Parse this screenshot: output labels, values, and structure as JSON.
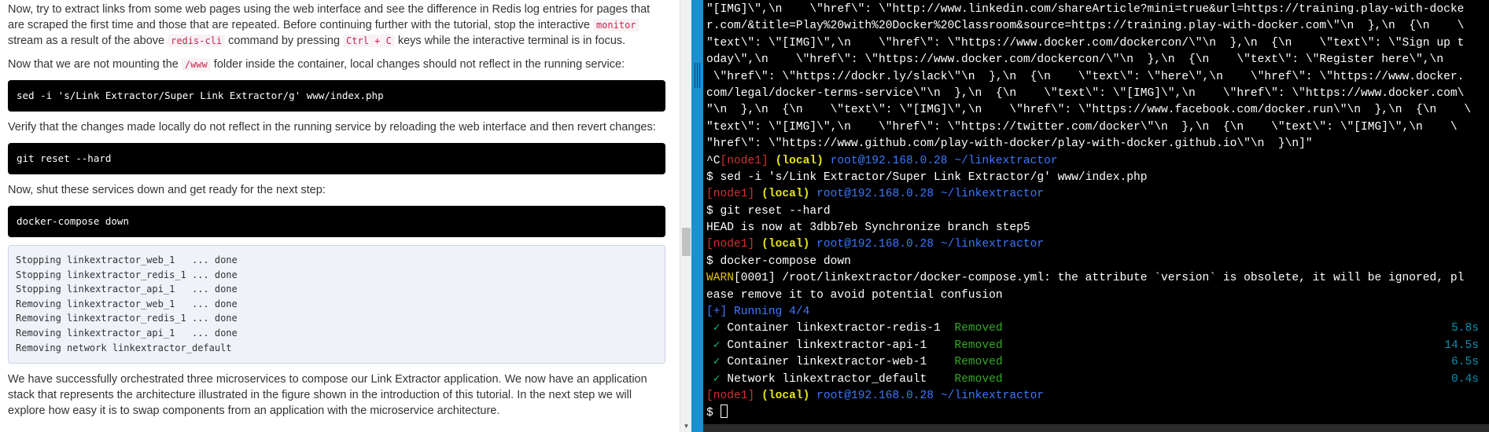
{
  "tutorial": {
    "p1": {
      "a": "Now, try to extract links from some web pages using the web interface and see the difference in Redis log entries for pages that are scraped the first time and those that are repeated. Before continuing further with the tutorial, stop the interactive ",
      "code1": "monitor",
      "b": " stream as a result of the above ",
      "code2": "redis-cli",
      "c": " command by pressing ",
      "kbd": "Ctrl + C",
      "d": " keys while the interactive terminal is in focus."
    },
    "p2": {
      "a": "Now that we are not mounting the ",
      "code": "/www",
      "b": " folder inside the container, local changes should not reflect in the running service:"
    },
    "cmd1": "sed -i 's/Link Extractor/Super Link Extractor/g' www/index.php",
    "p3": "Verify that the changes made locally do not reflect in the running service by reloading the web interface and then revert changes:",
    "cmd2": "git reset --hard",
    "p4": "Now, shut these services down and get ready for the next step:",
    "cmd3": "docker-compose down",
    "output_lines": [
      "Stopping linkextractor_web_1   ... done",
      "Stopping linkextractor_redis_1 ... done",
      "Stopping linkextractor_api_1   ... done",
      "Removing linkextractor_web_1   ... done",
      "Removing linkextractor_redis_1 ... done",
      "Removing linkextractor_api_1   ... done",
      "Removing network linkextractor_default"
    ],
    "p5": "We have successfully orchestrated three microservices to compose our Link Extractor application. We now have an application stack that represents the architecture illustrated in the figure shown in the introduction of this tutorial. In the next step we will explore how easy it is to swap components from an application with the microservice architecture."
  },
  "terminal": {
    "json_lines": [
      "\"[IMG]\\\",\\n    \\\"href\\\": \\\"http://www.linkedin.com/shareArticle?mini=true&url=https://training.play-with-docke",
      "r.com/&title=Play%20with%20Docker%20Classroom&source=https://training.play-with-docker.com\\\"\\n  },\\n  {\\n    \\",
      "\"text\\\": \\\"[IMG]\\\",\\n    \\\"href\\\": \\\"https://www.docker.com/dockercon/\\\"\\n  },\\n  {\\n    \\\"text\\\": \\\"Sign up t",
      "oday\\\",\\n    \\\"href\\\": \\\"https://www.docker.com/dockercon/\\\"\\n  },\\n  {\\n    \\\"text\\\": \\\"Register here\\\",\\n   ",
      " \\\"href\\\": \\\"https://dockr.ly/slack\\\"\\n  },\\n  {\\n    \\\"text\\\": \\\"here\\\",\\n    \\\"href\\\": \\\"https://www.docker.",
      "com/legal/docker-terms-service\\\"\\n  },\\n  {\\n    \\\"text\\\": \\\"[IMG]\\\",\\n    \\\"href\\\": \\\"https://www.docker.com\\",
      "\"\\n  },\\n  {\\n    \\\"text\\\": \\\"[IMG]\\\",\\n    \\\"href\\\": \\\"https://www.facebook.com/docker.run\\\"\\n  },\\n  {\\n    \\",
      "\"text\\\": \\\"[IMG]\\\",\\n    \\\"href\\\": \\\"https://twitter.com/docker\\\"\\n  },\\n  {\\n    \\\"text\\\": \\\"[IMG]\\\",\\n    \\",
      "\"href\\\": \\\"https://www.github.com/play-with-docker/play-with-docker.github.io\\\"\\n  }\\n]\""
    ],
    "interrupt": "^C",
    "prompt_node": "[node1]",
    "prompt_local": "(local)",
    "prompt_user": "root@192.168.0.28",
    "prompt_path": "~/linkextractor",
    "dollar": "$",
    "cmd1": "sed -i 's/Link Extractor/Super Link Extractor/g' www/index.php",
    "cmd2": "git reset --hard",
    "head_msg": "HEAD is now at 3dbb7eb Synchronize branch step5",
    "cmd3": "docker-compose down",
    "warn_tag": "WARN",
    "warn_line1": "[0001] /root/linkextractor/docker-compose.yml: the attribute `version` is obsolete, it will be ignored, pl",
    "warn_line2": "ease remove it to avoid potential confusion",
    "running": "[+] Running 4/4",
    "check": "✓",
    "containers": [
      {
        "name": "Container linkextractor-redis-1",
        "status": "Removed",
        "time": "5.8s"
      },
      {
        "name": "Container linkextractor-api-1",
        "status": "Removed",
        "time": "14.5s"
      },
      {
        "name": "Container linkextractor-web-1",
        "status": "Removed",
        "time": "6.5s"
      },
      {
        "name": "Network linkextractor_default",
        "status": "Removed",
        "time": "0.4s"
      }
    ]
  },
  "colors": {
    "splitter": "#1a8fd1",
    "terminal_bg": "#000000",
    "prompt_node": "#cd3131",
    "prompt_local": "#e5e510",
    "prompt_user": "#3b78ff",
    "removed": "#35a826"
  }
}
